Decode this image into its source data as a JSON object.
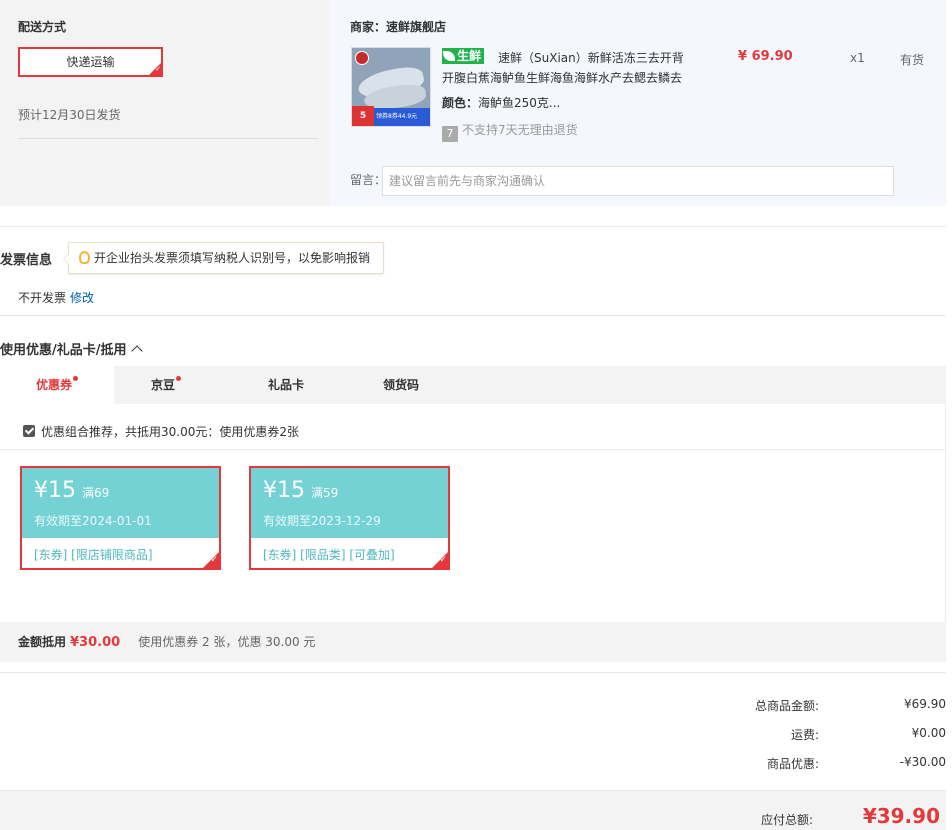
{
  "shipping": {
    "title": "配送方式",
    "method": "快递运输",
    "est_date": "预计12月30日发货"
  },
  "shop": {
    "name": "商家：速鲜旗舰店",
    "product": {
      "tag": "生鲜",
      "name": "速鲜（SuXian）新鲜活冻三去开背开腹白蕉海鲈鱼生鲜海鱼海鲜水产去鳃去鳞去",
      "color_label": "颜色：",
      "color_value": "海鲈鱼250克...",
      "return_icon": "7",
      "return_note": "不支持7天无理由退货",
      "price": "¥ 69.90",
      "qty": "x1",
      "stock": "有货",
      "image_badge": "5",
      "image_banner": "领券8券44.9元"
    },
    "memo_label": "留言：",
    "memo_placeholder": "建议留言前先与商家沟通确认"
  },
  "invoice": {
    "title": "发票信息",
    "tip": "开企业抬头发票须填写纳税人识别号，以免影响报销",
    "status": "不开发票",
    "edit": "修改"
  },
  "coupons": {
    "title": "使用优惠/礼品卡/抵用",
    "tabs": [
      {
        "label": "优惠券",
        "dot": true
      },
      {
        "label": "京豆",
        "dot": true
      },
      {
        "label": "礼品卡",
        "dot": false
      },
      {
        "label": "领货码",
        "dot": false
      }
    ],
    "combo_text": "优惠组合推荐，共抵用30.00元：使用优惠券2张",
    "items": [
      {
        "amount": "¥15",
        "condition": "满69",
        "expiry": "有效期至2024-01-01",
        "tags": "[东券]  [限店铺限商品]"
      },
      {
        "amount": "¥15",
        "condition": "满59",
        "expiry": "有效期至2023-12-29",
        "tags": "[东券]  [限品类]  [可叠加]"
      }
    ],
    "summary_label": "金额抵用",
    "summary_amount": "¥30.00",
    "summary_text": "使用优惠券 2 张，优惠 30.00 元"
  },
  "totals": {
    "goods_label": "总商品金额:",
    "goods_value": "¥69.90",
    "freight_label": "运费:",
    "freight_value": "¥0.00",
    "discount_label": "商品优惠:",
    "discount_value": "-¥30.00",
    "payable_label": "应付总额:",
    "payable_value": "¥39.90"
  },
  "colors": {
    "accent": "#e4393c",
    "coupon": "#74d2d4",
    "fresh_tag": "#1fb44a",
    "link": "#005ea7"
  }
}
